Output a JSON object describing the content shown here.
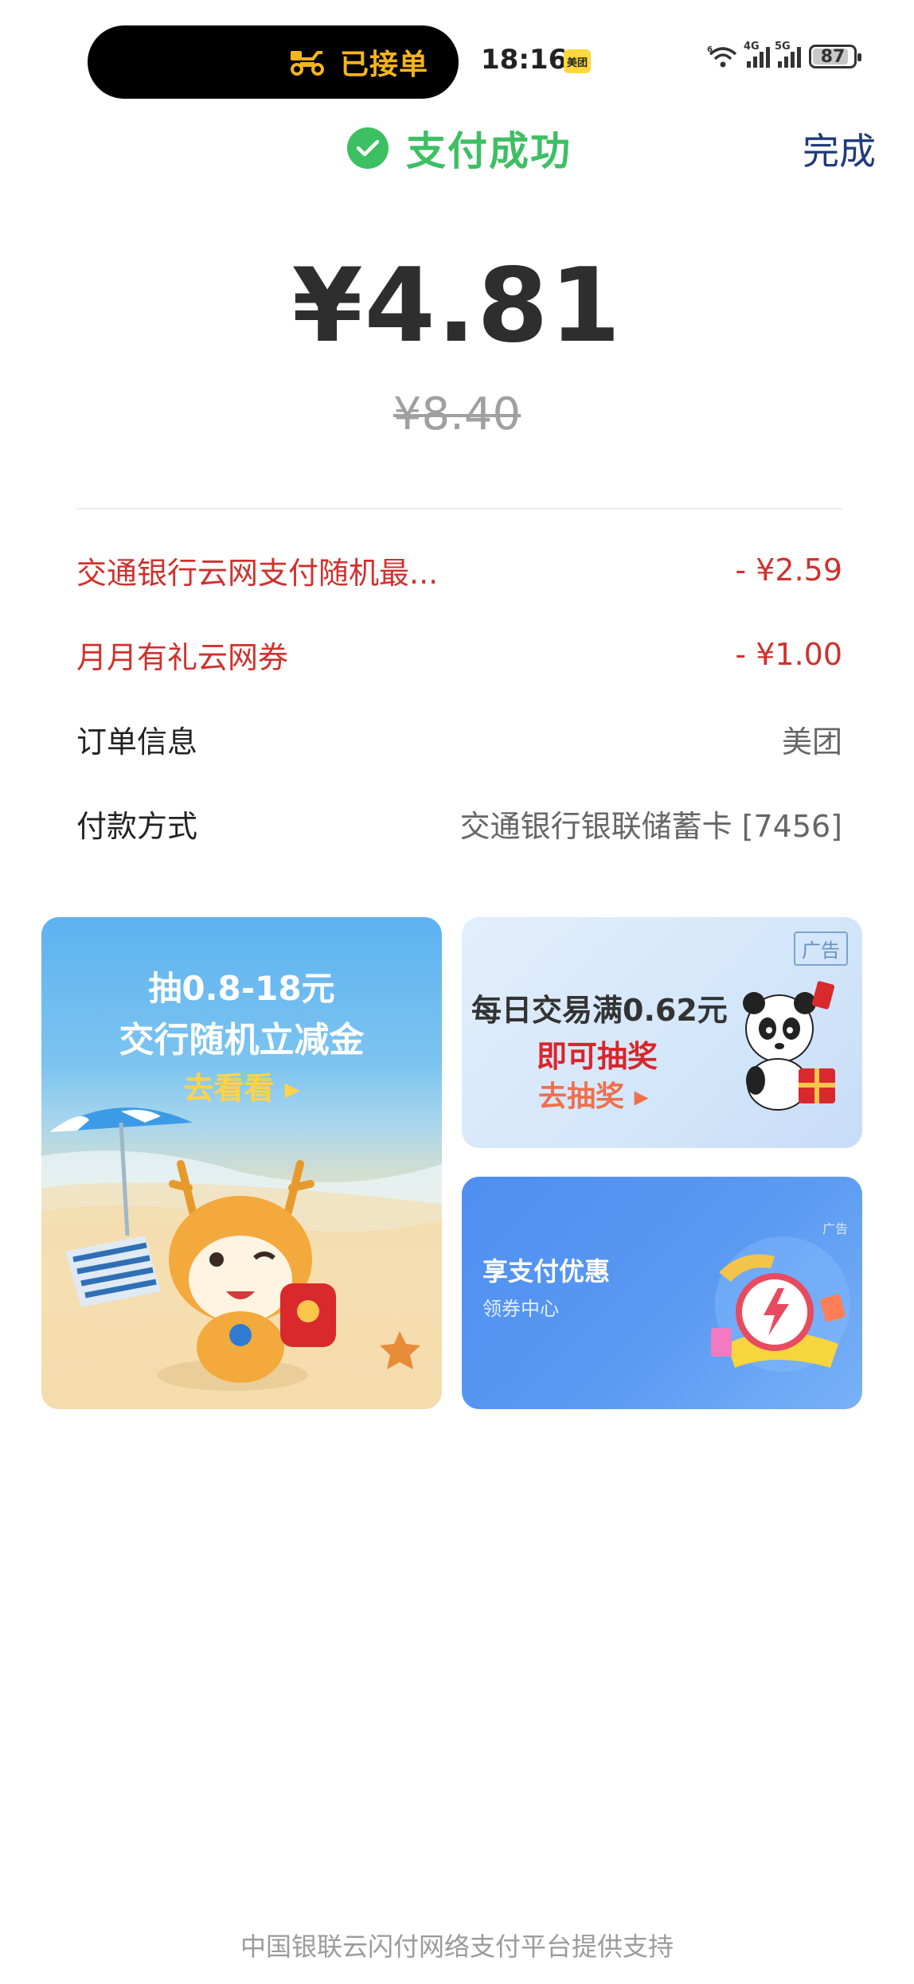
{
  "status_bar": {
    "live_activity": "已接单",
    "time": "18:16",
    "app_badge": "美团",
    "wifi_label": "6",
    "signal1_label": "4G",
    "signal2_label": "5G",
    "battery": "87",
    "battery_level_percent": 87
  },
  "header": {
    "status": "支付成功",
    "done_button": "完成"
  },
  "payment": {
    "amount": "¥4.81",
    "original_amount": "¥8.40"
  },
  "details": [
    {
      "label": "交通银行云网支付随机最...",
      "value": "- ¥2.59",
      "highlight": true
    },
    {
      "label": "月月有礼云网券",
      "value": "- ¥1.00",
      "highlight": true
    },
    {
      "label": "订单信息",
      "value": "美团",
      "highlight": false
    },
    {
      "label": "付款方式",
      "value": "交通银行银联储蓄卡 [7456]",
      "highlight": false
    }
  ],
  "promo_left": {
    "line1": "抽0.8-18元",
    "line2": "交行随机立减金",
    "cta": "去看看 ▸"
  },
  "promo_top_right": {
    "ad_tag": "广告",
    "line1": "每日交易满0.62元",
    "line2": "即可抽奖",
    "cta": "去抽奖 ▸"
  },
  "promo_bottom_right": {
    "ad_tag": "广告",
    "title": "享支付优惠",
    "subtitle": "领券中心"
  },
  "footer": "中国银联云闪付网络支付平台提供支持",
  "colors": {
    "success_green": "#3dbf63",
    "discount_red": "#d0312d",
    "done_blue": "#1f3b7a",
    "pill_yellow": "#f5b51b"
  }
}
